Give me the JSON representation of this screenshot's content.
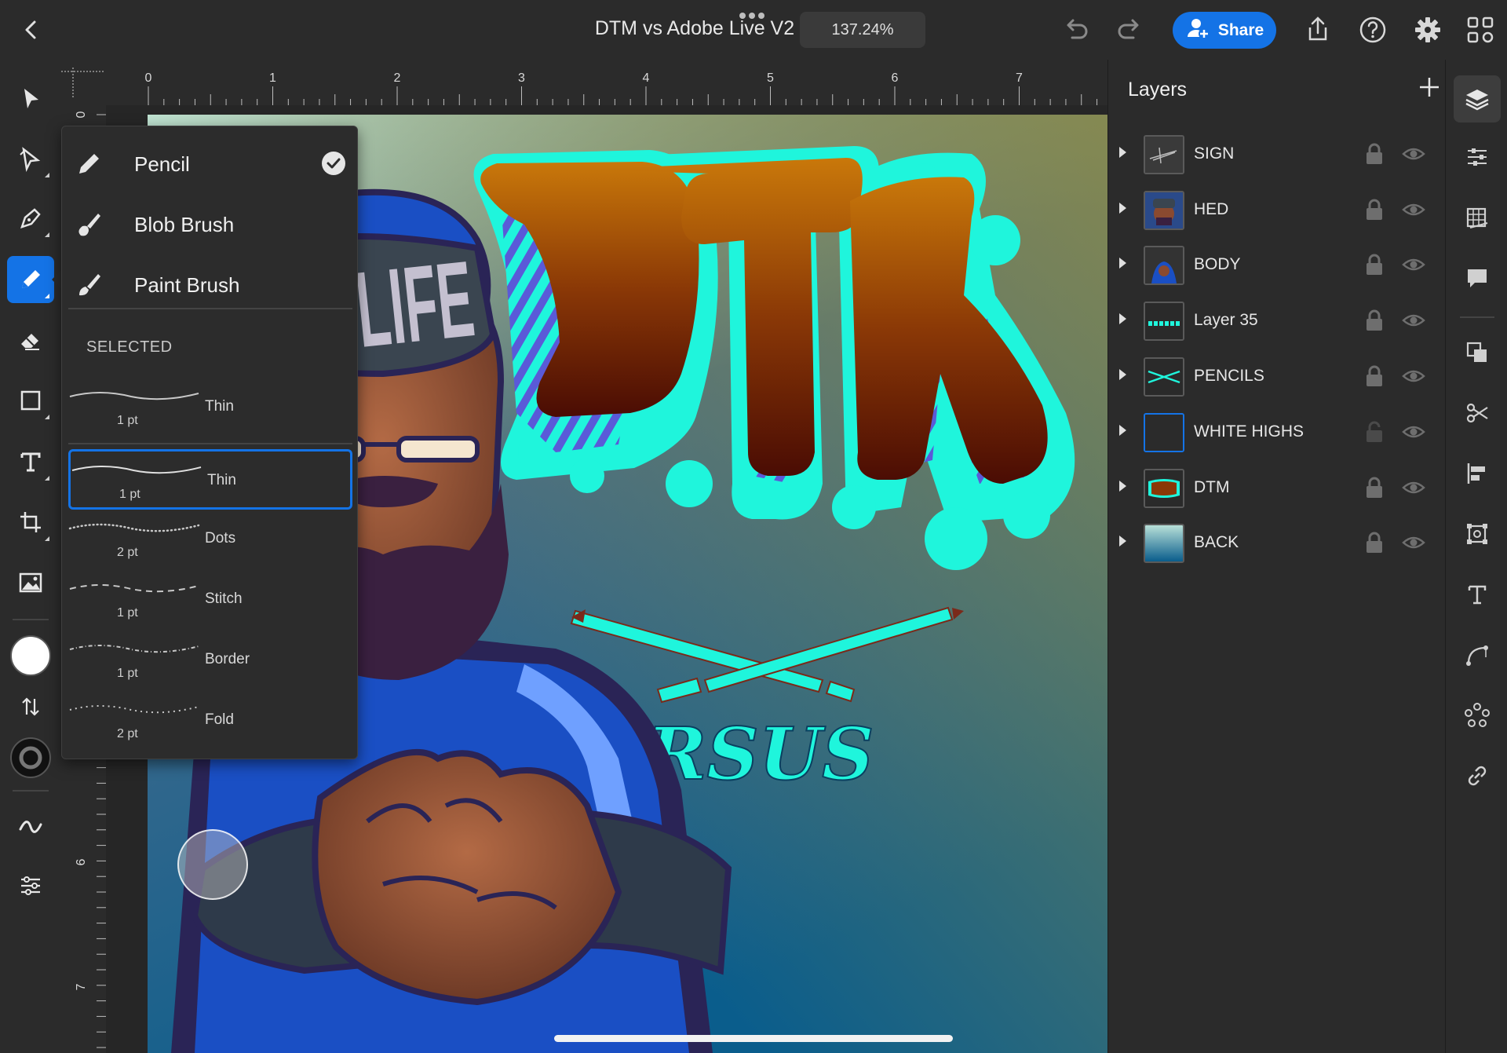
{
  "topbar": {
    "document_title": "DTM vs Adobe Live V2",
    "zoom_level": "137.24%",
    "share_label": "Share"
  },
  "ruler": {
    "h_labels": [
      "0",
      "1",
      "2",
      "3",
      "4",
      "5",
      "6",
      "7"
    ],
    "v_labels": [
      "0",
      "6",
      "7"
    ]
  },
  "brush_menu": {
    "types": [
      {
        "label": "Pencil",
        "icon": "pencil-icon",
        "checked": true
      },
      {
        "label": "Blob Brush",
        "icon": "blob-brush-icon",
        "checked": false
      },
      {
        "label": "Paint Brush",
        "icon": "paint-brush-icon",
        "checked": false
      }
    ],
    "selected_heading": "SELECTED",
    "presets": [
      {
        "name": "Thin",
        "size": "1 pt",
        "style": "solid",
        "selected": false
      },
      {
        "name": "Thin",
        "size": "1 pt",
        "style": "solid",
        "selected": true
      },
      {
        "name": "Dots",
        "size": "2 pt",
        "style": "dots",
        "selected": false
      },
      {
        "name": "Stitch",
        "size": "1 pt",
        "style": "stitch",
        "selected": false
      },
      {
        "name": "Border",
        "size": "1 pt",
        "style": "border",
        "selected": false
      },
      {
        "name": "Fold",
        "size": "2 pt",
        "style": "fold",
        "selected": false
      }
    ]
  },
  "layers": {
    "title": "Layers",
    "items": [
      {
        "name": "SIGN",
        "locked": true
      },
      {
        "name": "HED",
        "locked": true
      },
      {
        "name": "BODY",
        "locked": true
      },
      {
        "name": "Layer 35",
        "locked": true
      },
      {
        "name": "PENCILS",
        "locked": true
      },
      {
        "name": "WHITE HIGHS",
        "locked": false
      },
      {
        "name": "DTM",
        "locked": true
      },
      {
        "name": "BACK",
        "locked": true
      }
    ]
  },
  "artwork": {
    "headline": "DTM",
    "subhead": "VERSUS",
    "cap_text": "RT LIFE"
  },
  "colors": {
    "accent": "#1473e6",
    "cyan": "#1ff5dc",
    "fill_swatch": "#ffffff",
    "stroke_swatch": "#111111"
  }
}
